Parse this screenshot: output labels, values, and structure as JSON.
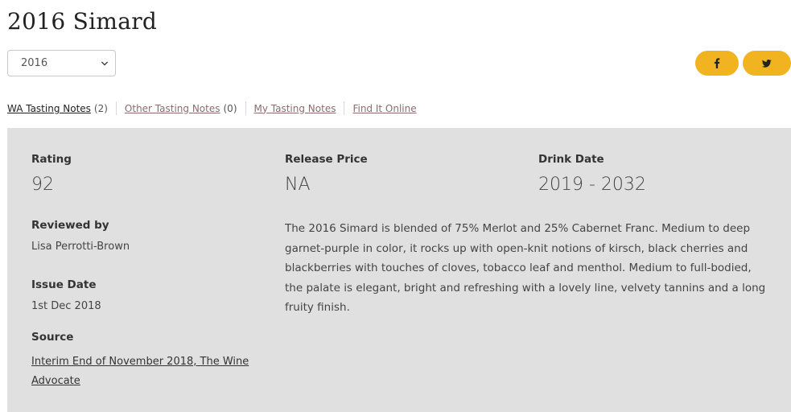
{
  "page": {
    "title": "2016 Simard"
  },
  "vintage_select": {
    "selected": "2016"
  },
  "share": {
    "facebook_icon": "facebook-icon",
    "twitter_icon": "twitter-icon",
    "accent": "#f2b321"
  },
  "tabs": [
    {
      "label": "WA Tasting Notes",
      "count": "(2)"
    },
    {
      "label": "Other Tasting Notes",
      "count": "(0)"
    },
    {
      "label": "My Tasting Notes"
    },
    {
      "label": "Find It Online"
    }
  ],
  "review": {
    "rating_label": "Rating",
    "rating": "92",
    "release_price_label": "Release Price",
    "release_price": "NA",
    "drink_date_label": "Drink Date",
    "drink_date": "2019 - 2032",
    "reviewed_by_label": "Reviewed by",
    "reviewer": "Lisa Perrotti-Brown",
    "issue_date_label": "Issue Date",
    "issue_date": "1st Dec 2018",
    "source_label": "Source",
    "source": "Interim End of November 2018, The Wine Advocate",
    "note": "The 2016 Simard is blended of 75% Merlot and 25% Cabernet Franc. Medium to deep garnet-purple in color, it rocks up with open-knit notions of kirsch, black cherries and blackberries with touches of cloves, tobacco leaf and menthol. Medium to full-bodied, the palate is elegant, bright and refreshing with a lovely line, velvety tannins and a long fruity finish."
  }
}
